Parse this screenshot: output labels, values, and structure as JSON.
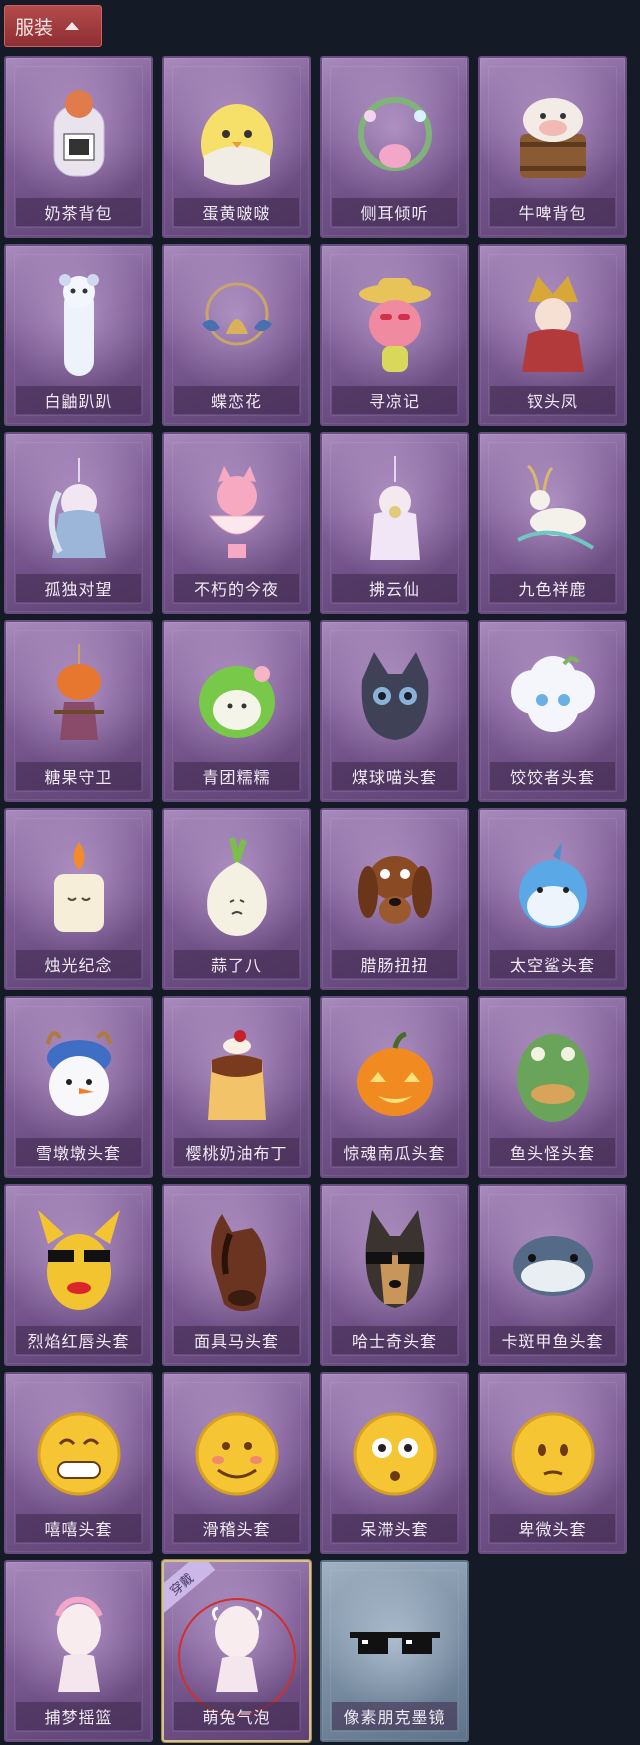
{
  "header": {
    "tab_label": "服装"
  },
  "items": [
    {
      "label": "奶茶背包",
      "icon": "milk-tea-backpack-icon"
    },
    {
      "label": "蛋黄啵啵",
      "icon": "chick-egg-icon"
    },
    {
      "label": "侧耳倾听",
      "icon": "flower-wreath-icon"
    },
    {
      "label": "牛啤背包",
      "icon": "cow-barrel-icon"
    },
    {
      "label": "白鼬趴趴",
      "icon": "white-weasel-icon"
    },
    {
      "label": "蝶恋花",
      "icon": "butterfly-bell-icon"
    },
    {
      "label": "寻凉记",
      "icon": "pink-creature-hat-icon"
    },
    {
      "label": "钗头凤",
      "icon": "phoenix-crown-doll-icon"
    },
    {
      "label": "孤独对望",
      "icon": "fairy-charm-icon"
    },
    {
      "label": "不朽的今夜",
      "icon": "pink-fox-bowl-icon"
    },
    {
      "label": "拂云仙",
      "icon": "cloud-fairy-charm-icon"
    },
    {
      "label": "九色祥鹿",
      "icon": "deer-charm-icon"
    },
    {
      "label": "糖果守卫",
      "icon": "pumpkin-scarecrow-icon"
    },
    {
      "label": "青团糯糯",
      "icon": "green-dumpling-icon"
    },
    {
      "label": "煤球喵头套",
      "icon": "black-cat-head-icon"
    },
    {
      "label": "饺饺者头套",
      "icon": "dumpling-cloud-head-icon"
    },
    {
      "label": "烛光纪念",
      "icon": "candle-icon"
    },
    {
      "label": "蒜了八",
      "icon": "garlic-icon"
    },
    {
      "label": "腊肠扭扭",
      "icon": "dachshund-head-icon"
    },
    {
      "label": "太空鲨头套",
      "icon": "shark-head-icon"
    },
    {
      "label": "雪墩墩头套",
      "icon": "snowman-head-icon"
    },
    {
      "label": "樱桃奶油布丁",
      "icon": "pudding-icon"
    },
    {
      "label": "惊魂南瓜头套",
      "icon": "pumpkin-head-icon"
    },
    {
      "label": "鱼头怪头套",
      "icon": "fish-head-icon"
    },
    {
      "label": "烈焰红唇头套",
      "icon": "yellow-mouse-head-icon"
    },
    {
      "label": "面具马头套",
      "icon": "horse-head-icon"
    },
    {
      "label": "哈士奇头套",
      "icon": "husky-head-icon"
    },
    {
      "label": "卡斑甲鱼头套",
      "icon": "spotted-fish-head-icon"
    },
    {
      "label": "嘻嘻头套",
      "icon": "grin-emoji-icon"
    },
    {
      "label": "滑稽头套",
      "icon": "smirk-emoji-icon"
    },
    {
      "label": "呆滞头套",
      "icon": "stare-emoji-icon"
    },
    {
      "label": "卑微头套",
      "icon": "humble-emoji-icon"
    },
    {
      "label": "捕梦摇篮",
      "icon": "dream-cradle-head-icon"
    },
    {
      "label": "萌兔气泡",
      "icon": "bunny-bubble-head-icon",
      "equipped": true,
      "badge": "穿戴"
    },
    {
      "label": "像素朋克墨镜",
      "icon": "pixel-sunglasses-icon",
      "variant": "blue"
    }
  ],
  "colors": {
    "background": "#141a26",
    "card_purple": "#7b5a92",
    "card_blue": "#7a8ea3",
    "tab_red": "#9e3a3e",
    "equipped_outline": "#d9c28a",
    "selection_ring": "#d0302c"
  }
}
